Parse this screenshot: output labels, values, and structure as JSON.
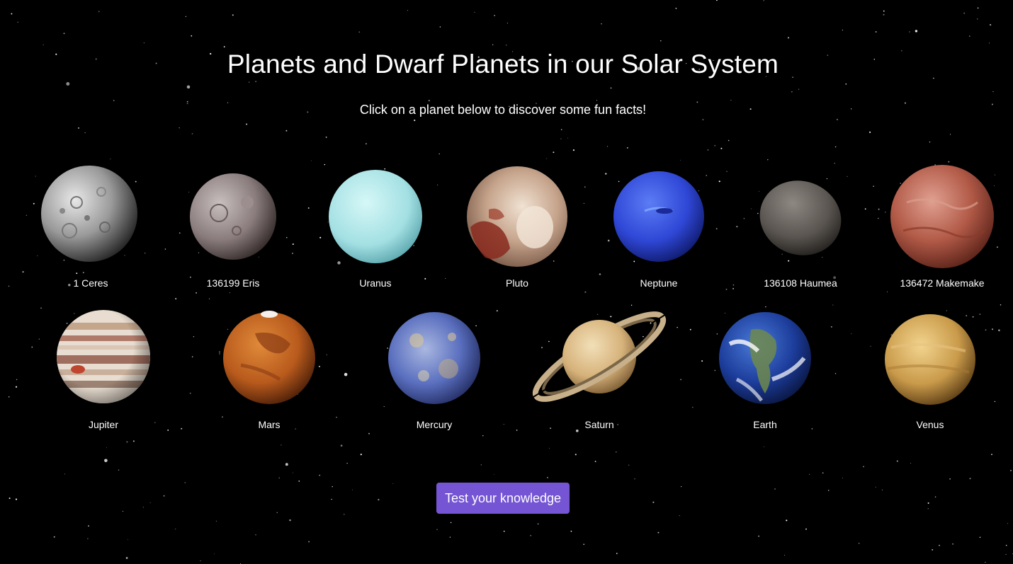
{
  "header": {
    "title": "Planets and Dwarf Planets in our Solar System",
    "subtitle": "Click on a planet below to discover some fun facts!"
  },
  "planets": [
    {
      "name": "1 Ceres",
      "icon": "ceres-image"
    },
    {
      "name": "136199 Eris",
      "icon": "eris-image"
    },
    {
      "name": "Uranus",
      "icon": "uranus-image"
    },
    {
      "name": "Pluto",
      "icon": "pluto-image"
    },
    {
      "name": "Neptune",
      "icon": "neptune-image"
    },
    {
      "name": "136108 Haumea",
      "icon": "haumea-image"
    },
    {
      "name": "136472 Makemake",
      "icon": "makemake-image"
    },
    {
      "name": "Jupiter",
      "icon": "jupiter-image"
    },
    {
      "name": "Mars",
      "icon": "mars-image"
    },
    {
      "name": "Mercury",
      "icon": "mercury-image"
    },
    {
      "name": "Saturn",
      "icon": "saturn-image"
    },
    {
      "name": "Earth",
      "icon": "earth-image"
    },
    {
      "name": "Venus",
      "icon": "venus-image"
    }
  ],
  "quiz": {
    "button_label": "Test your knowledge"
  },
  "colors": {
    "background": "#000000",
    "button": "#7555d4",
    "text": "#ffffff"
  }
}
